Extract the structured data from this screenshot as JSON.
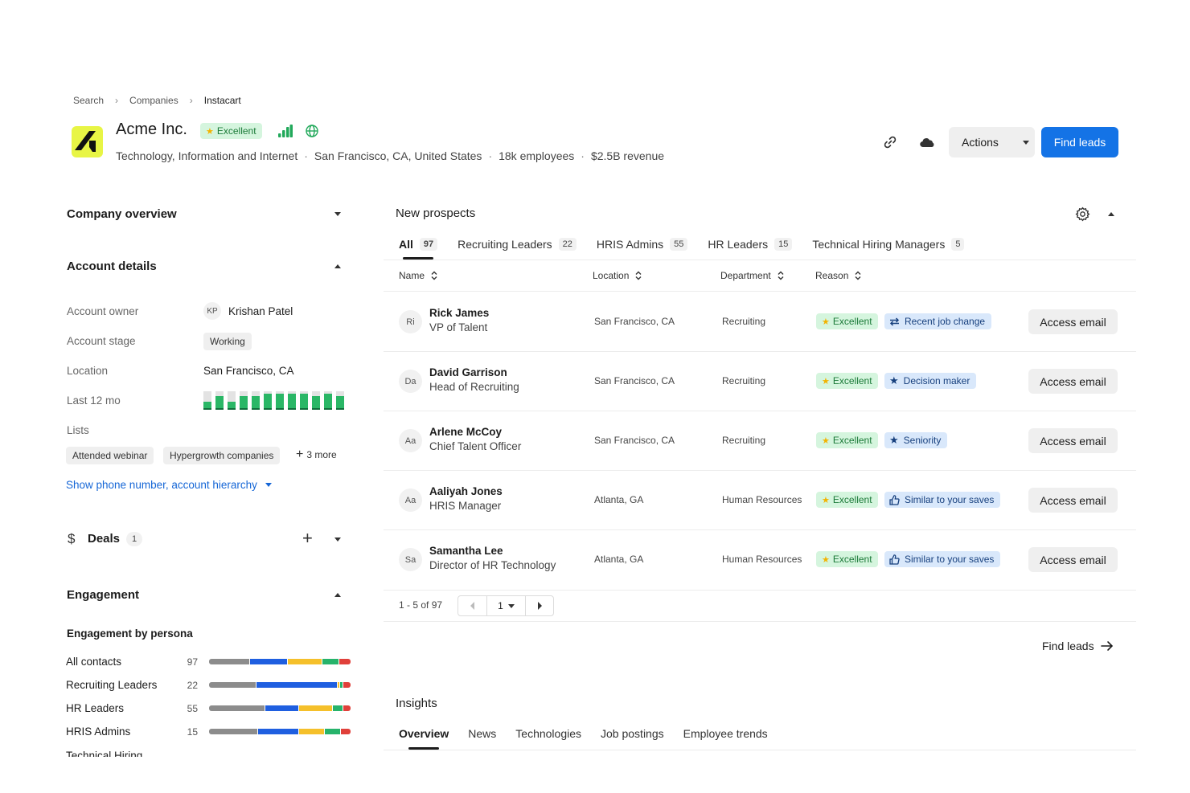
{
  "breadcrumb": {
    "items": [
      "Search",
      "Companies",
      "Instacart"
    ]
  },
  "company": {
    "name": "Acme Inc.",
    "rating": "Excellent",
    "industry": "Technology, Information and Internet",
    "location": "San Francisco, CA, United States",
    "employees": "18k employees",
    "revenue": "$2.5B revenue"
  },
  "header_actions": {
    "actions_label": "Actions",
    "find_leads_label": "Find leads"
  },
  "left": {
    "company_overview": "Company overview",
    "account_details": "Account details",
    "account_owner_label": "Account owner",
    "account_owner_initials": "KP",
    "account_owner": "Krishan Patel",
    "account_stage_label": "Account stage",
    "account_stage": "Working",
    "location_label": "Location",
    "location": "San Francisco, CA",
    "last12_label": "Last 12 mo",
    "last12_values": [
      0.45,
      0.75,
      0.45,
      0.75,
      0.75,
      0.85,
      0.85,
      0.85,
      0.85,
      0.75,
      0.85,
      0.75
    ],
    "lists_label": "Lists",
    "lists": [
      "Attended webinar",
      "Hypergrowth companies"
    ],
    "lists_more": "3 more",
    "show_more_link": "Show phone number, account hierarchy",
    "deals_title": "Deals",
    "deals_count": "1",
    "engagement_title": "Engagement",
    "engagement_subtitle": "Engagement by persona",
    "engagement_cut": "Technical Hiring"
  },
  "engagement_colors": [
    "#8c8c8c",
    "#1f5fe0",
    "#f5c02b",
    "#27b36b",
    "#e0403a"
  ],
  "engagement": [
    {
      "name": "All contacts",
      "count": "97",
      "segments": [
        0.29,
        0.27,
        0.24,
        0.12,
        0.08
      ]
    },
    {
      "name": "Recruiting Leaders",
      "count": "22",
      "segments": [
        0.33,
        0.57,
        0.01,
        0.02,
        0.05
      ]
    },
    {
      "name": "HR Leaders",
      "count": "55",
      "segments": [
        0.4,
        0.24,
        0.24,
        0.07,
        0.05
      ]
    },
    {
      "name": "HRIS Admins",
      "count": "15",
      "segments": [
        0.35,
        0.29,
        0.18,
        0.11,
        0.07
      ]
    }
  ],
  "prospects": {
    "title": "New prospects",
    "tabs": [
      {
        "label": "All",
        "count": "97"
      },
      {
        "label": "Recruiting Leaders",
        "count": "22"
      },
      {
        "label": "HRIS Admins",
        "count": "55"
      },
      {
        "label": "HR Leaders",
        "count": "15"
      },
      {
        "label": "Technical Hiring Managers",
        "count": "5"
      }
    ],
    "columns": [
      "Name",
      "Location",
      "Department",
      "Reason"
    ],
    "rows": [
      {
        "initials": "Ri",
        "name": "Rick James",
        "title": "VP of Talent",
        "location": "San Francisco, CA",
        "department": "Recruiting",
        "rating": "Excellent",
        "reason": "Recent job change",
        "reason_icon": "swap-icon",
        "action": "Access email"
      },
      {
        "initials": "Da",
        "name": "David Garrison",
        "title": "Head of Recruiting",
        "location": "San Francisco, CA",
        "department": "Recruiting",
        "rating": "Excellent",
        "reason": "Decision maker",
        "reason_icon": "star-icon",
        "action": "Access email"
      },
      {
        "initials": "Aa",
        "name": "Arlene McCoy",
        "title": "Chief Talent Officer",
        "location": "San Francisco, CA",
        "department": "Recruiting",
        "rating": "Excellent",
        "reason": "Seniority",
        "reason_icon": "star-icon",
        "action": "Access email"
      },
      {
        "initials": "Aa",
        "name": "Aaliyah Jones",
        "title": "HRIS Manager",
        "location": "Atlanta, GA",
        "department": "Human Resources",
        "rating": "Excellent",
        "reason": "Similar to your saves",
        "reason_icon": "thumbs-up-icon",
        "action": "Access email"
      },
      {
        "initials": "Sa",
        "name": "Samantha Lee",
        "title": "Director of HR Technology",
        "location": "Atlanta, GA",
        "department": "Human Resources",
        "rating": "Excellent",
        "reason": "Similar to your saves",
        "reason_icon": "thumbs-up-icon",
        "action": "Access email"
      }
    ],
    "pagination_text": "1 - 5 of 97",
    "page": "1",
    "find_leads_link": "Find leads"
  },
  "insights": {
    "title": "Insights",
    "tabs": [
      "Overview",
      "News",
      "Technologies",
      "Job postings",
      "Employee trends"
    ]
  }
}
